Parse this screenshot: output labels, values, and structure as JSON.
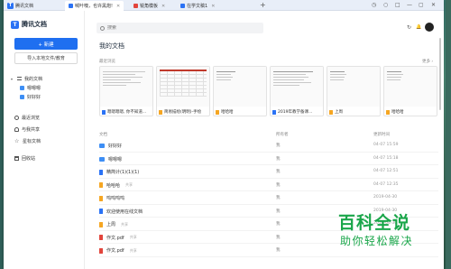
{
  "titlebar": {
    "app_name": "腾讯文档",
    "tabs": [
      {
        "label": "喊叶噢，也许黑炮!",
        "active": true,
        "color": "#2a72f5"
      },
      {
        "label": "锐角模板",
        "active": false,
        "color": "#e2453c"
      },
      {
        "label": "在学文稿1",
        "active": false,
        "color": "#2a72f5"
      }
    ],
    "add_tab": "+",
    "controls": [
      "◷",
      "○",
      "□",
      "—",
      "▢",
      "✕"
    ]
  },
  "sidebar": {
    "brand": "腾讯文档",
    "new_button": "+ 新建",
    "import_button": "导入本地文件/教育",
    "nav": [
      {
        "label": "我的文档",
        "icon": "list-icon",
        "caret": "▾"
      },
      {
        "label": "嗯嗯嗯",
        "icon": "folder-icon",
        "indent": true
      },
      {
        "label": "好好好",
        "icon": "folder-icon",
        "indent": true
      },
      {
        "label": "最近浏览",
        "icon": "clock-icon"
      },
      {
        "label": "与我共享",
        "icon": "person-icon"
      },
      {
        "label": "星标文档",
        "icon": "star-icon"
      },
      {
        "label": "回收站",
        "icon": "trash-icon"
      }
    ]
  },
  "main": {
    "search_placeholder": "搜索",
    "top_icons": [
      "↻",
      "🔔"
    ],
    "page_title": "我的文档",
    "recent_label": "最近浏览",
    "more_label": "更多 ›",
    "recent_cards": [
      {
        "caption": "嗯嗯嗯嗯, 你不知道...",
        "kind": "doc",
        "preview": "text"
      },
      {
        "caption": "简易描绘(明明)-手绘",
        "kind": "sheet",
        "preview": "grid"
      },
      {
        "caption": "哈哈哈",
        "kind": "sheet",
        "preview": "text"
      },
      {
        "caption": "2019年教学备课...",
        "kind": "doc",
        "preview": "text"
      },
      {
        "caption": "上周",
        "kind": "sheet",
        "preview": "text"
      },
      {
        "caption": "哈哈哈",
        "kind": "sheet",
        "preview": "text"
      }
    ],
    "list_headers": {
      "name": "文档",
      "owner": "所有者",
      "date": "更新时间"
    },
    "rows": [
      {
        "name": "好好好",
        "type": "folder",
        "owner": "我",
        "date": "04-07 15:59",
        "tag": ""
      },
      {
        "name": "嗯嗯嗯",
        "type": "folder",
        "owner": "我",
        "date": "04-07 15:18",
        "tag": ""
      },
      {
        "name": "精简计(1)(1)(1)",
        "type": "doc",
        "owner": "我",
        "date": "04-07 12:51",
        "tag": ""
      },
      {
        "name": "哈哈哈",
        "type": "sheet",
        "owner": "我",
        "date": "04-07 12:35",
        "tag": "共享"
      },
      {
        "name": "呜呜呜呜",
        "type": "sheet",
        "owner": "我",
        "date": "2019-04-30",
        "tag": ""
      },
      {
        "name": "欢迎使用在线文档",
        "type": "doc",
        "owner": "我",
        "date": "2019-04-30",
        "tag": ""
      },
      {
        "name": "上周",
        "type": "sheet",
        "owner": "我",
        "date": "2019-04-30",
        "tag": "共享"
      },
      {
        "name": "作文.pdf",
        "type": "pdf",
        "owner": "我",
        "date": "",
        "tag": "共享"
      },
      {
        "name": "作文.pdf",
        "type": "pdf",
        "owner": "我",
        "date": "",
        "tag": "共享"
      }
    ]
  },
  "watermark": {
    "main": "百科全说",
    "sub": "助你轻松解决"
  },
  "colors": {
    "accent": "#1f6ff0",
    "folder": "#3d8ef5",
    "sheet": "#f5a623",
    "pdf": "#e2453c",
    "watermark": "#1aa64a"
  }
}
